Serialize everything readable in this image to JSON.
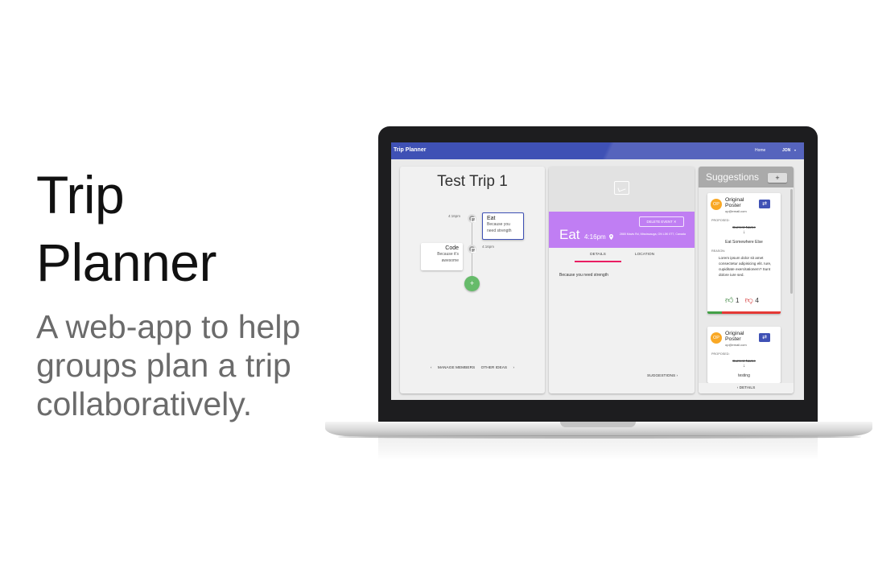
{
  "hero": {
    "title_line1": "Trip",
    "title_line2": "Planner",
    "subtitle": "A web-app to help groups plan a trip collaboratively."
  },
  "appbar": {
    "title": "Trip Planner",
    "nav_home": "Home",
    "nav_user": "JON",
    "nav_caret": "▾",
    "color": "#3f51b5"
  },
  "trip": {
    "title": "Test Trip 1",
    "timeline": [
      {
        "time": "4:16pm",
        "name": "Eat",
        "description": "Because you need strength",
        "selected": true
      },
      {
        "time": "4:16pm",
        "name": "Code",
        "description": "Because it's awesome",
        "selected": false
      }
    ],
    "add_button": "+",
    "footer_left": "‹",
    "manage_members": "MANAGE MEMBERS",
    "other_ideas": "OTHER IDEAS",
    "footer_right": "›"
  },
  "event": {
    "image_icon": "image-placeholder-icon",
    "delete_button": "DELETE EVENT ✕",
    "title": "Eat",
    "time": "4:16pm",
    "pin_icon": "location-pin-icon",
    "address": "2865 Mavis Rd, Mississauga, ON L5K 0T7, Canada",
    "tabs": [
      "DETAILS",
      "LOCATION"
    ],
    "active_tab": "DETAILS",
    "description": "Because you need strength",
    "suggestions_link": "SUGGESTIONS ›",
    "banner_color": "#c07ef3"
  },
  "suggestions": {
    "title": "Suggestions",
    "add_button": "+",
    "items": [
      {
        "avatar": "OP",
        "name": "Original Poster",
        "email": "op@email.com",
        "swap_icon": "⇄",
        "proposed_label": "PROPOSED:",
        "old_value": "Current Name",
        "arrow": "↓",
        "new_value": "Eat Somewhere Else",
        "reason_label": "REASON:",
        "reason": "Lorem ipsum dolor sit amet consectetur adipisicing elit. Iure, cupiditate exercitationem? Sunt dolore iure sed.",
        "upvotes": "1",
        "downvotes": "4",
        "upvote_fraction": 0.2
      },
      {
        "avatar": "OP",
        "name": "Original Poster",
        "email": "op@email.com",
        "swap_icon": "⇄",
        "proposed_label": "PROPOSED:",
        "old_value": "Current Name",
        "arrow": "↓",
        "new_value": "testing"
      }
    ],
    "footer": "‹  DETAILS"
  }
}
